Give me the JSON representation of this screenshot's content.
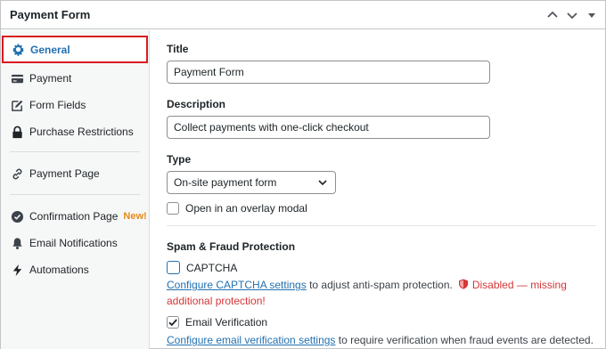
{
  "header": {
    "title": "Payment Form"
  },
  "sidebar": {
    "items": [
      {
        "label": "General",
        "icon": "gear-icon"
      },
      {
        "label": "Payment",
        "icon": "credit-card-icon"
      },
      {
        "label": "Form Fields",
        "icon": "edit-icon"
      },
      {
        "label": "Purchase Restrictions",
        "icon": "lock-icon"
      },
      {
        "label": "Payment Page",
        "icon": "link-icon"
      },
      {
        "label": "Confirmation Page",
        "icon": "check-circle-icon",
        "badge": "New!"
      },
      {
        "label": "Email Notifications",
        "icon": "bell-icon"
      },
      {
        "label": "Automations",
        "icon": "bolt-icon"
      }
    ]
  },
  "main": {
    "title_label": "Title",
    "title_value": "Payment Form",
    "description_label": "Description",
    "description_value": "Collect payments with one-click checkout",
    "type_label": "Type",
    "type_value": "On-site payment form",
    "overlay_label": "Open in an overlay modal",
    "spam_heading": "Spam & Fraud Protection",
    "captcha_label": "CAPTCHA",
    "captcha_link": "Configure CAPTCHA settings",
    "captcha_help": " to adjust anti-spam protection.",
    "captcha_status": "Disabled — missing additional protection!",
    "email_verif_label": "Email Verification",
    "email_verif_link": "Configure email verification settings",
    "email_verif_help": " to require verification when fraud events are detected."
  },
  "colors": {
    "accent": "#2271b1",
    "highlight_border": "#d81b20",
    "badge": "#e38b1b",
    "error": "#d63638"
  }
}
